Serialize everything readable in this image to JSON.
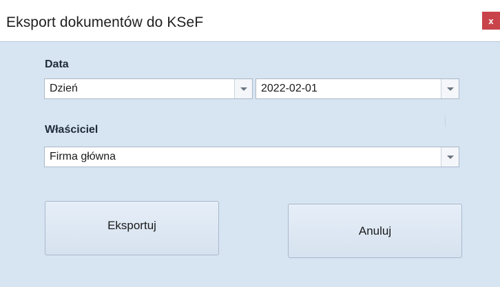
{
  "window": {
    "title": "Eksport dokumentów do KSeF",
    "close_label": "x"
  },
  "form": {
    "data_label": "Data",
    "date_type": {
      "selected": "Dzień"
    },
    "date_value": {
      "selected": "2022-02-01"
    },
    "owner_label": "Właściciel",
    "owner": {
      "selected": "Firma główna"
    }
  },
  "buttons": {
    "export_label": "Eksportuj",
    "cancel_label": "Anuluj"
  },
  "colors": {
    "body_background": "#d7e4f2",
    "close_button": "#c8434a"
  }
}
